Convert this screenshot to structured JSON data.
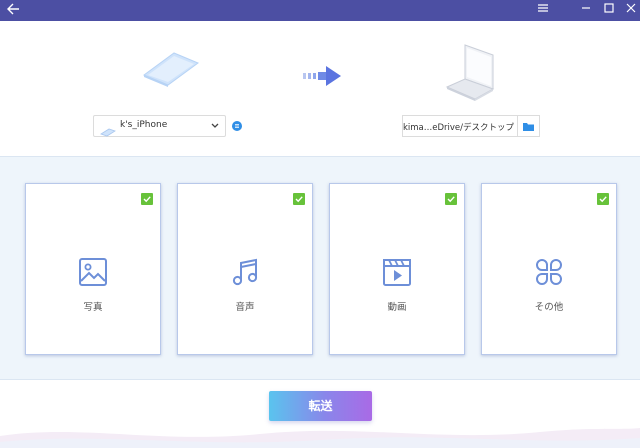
{
  "titlebar": {
    "back_icon": "arrow-left-icon",
    "controls": [
      "menu-icon",
      "minimize-icon",
      "maximize-icon",
      "close-icon"
    ]
  },
  "source": {
    "device_name": "k's_iPhone",
    "info_icon": "info-icon"
  },
  "destination": {
    "path": "ers/kima…eDrive/デスクトップ",
    "folder_icon": "folder-icon"
  },
  "categories": [
    {
      "label": "写真",
      "icon": "image-icon",
      "checked": true
    },
    {
      "label": "音声",
      "icon": "music-note-icon",
      "checked": true
    },
    {
      "label": "動画",
      "icon": "video-clapper-icon",
      "checked": true
    },
    {
      "label": "その他",
      "icon": "grid-other-icon",
      "checked": true
    }
  ],
  "action": {
    "transfer_label": "転送"
  },
  "colors": {
    "titlebar": "#4c4fa3",
    "icon_accent": "#6d8fd8",
    "check_green": "#67c23a",
    "middle_bg": "#eef5fb"
  }
}
